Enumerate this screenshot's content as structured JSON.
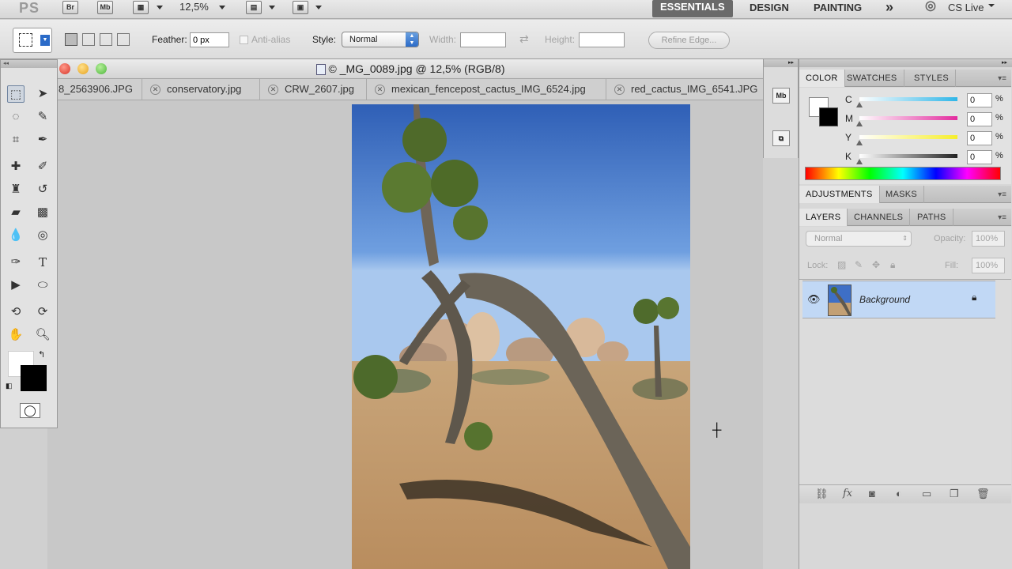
{
  "app": {
    "logo": "PS",
    "br": "Br",
    "mb": "Mb",
    "zoom": "12,5%",
    "workspaces": [
      "ESSENTIALS",
      "DESIGN",
      "PAINTING"
    ],
    "more": "»",
    "cslive": "CS Live"
  },
  "options": {
    "feather_label": "Feather:",
    "feather_value": "0 px",
    "antialias_label": "Anti-alias",
    "style_label": "Style:",
    "style_value": "Normal",
    "width_label": "Width:",
    "height_label": "Height:",
    "refine_label": "Refine Edge..."
  },
  "document": {
    "title": "© _MG_0089.jpg @ 12,5% (RGB/8)",
    "tabs": [
      "8_2563906.JPG",
      "conservatory.jpg",
      "CRW_2607.jpg",
      "mexican_fencepost_cactus_IMG_6524.jpg",
      "red_cactus_IMG_6541.JPG"
    ]
  },
  "color_panel": {
    "tabs": [
      "COLOR",
      "SWATCHES",
      "STYLES"
    ],
    "channels": [
      {
        "label": "C",
        "value": "0",
        "color": "#2fb6e8"
      },
      {
        "label": "M",
        "value": "0",
        "color": "#e32b9e"
      },
      {
        "label": "Y",
        "value": "0",
        "color": "#f6ee2c"
      },
      {
        "label": "K",
        "value": "0",
        "color": "#222222"
      }
    ],
    "unit": "%"
  },
  "adjust_panel": {
    "tabs": [
      "ADJUSTMENTS",
      "MASKS"
    ]
  },
  "layers_panel": {
    "tabs": [
      "LAYERS",
      "CHANNELS",
      "PATHS"
    ],
    "blend_mode": "Normal",
    "opacity_label": "Opacity:",
    "opacity_value": "100%",
    "lock_label": "Lock:",
    "fill_label": "Fill:",
    "fill_value": "100%",
    "layer_name": "Background"
  }
}
